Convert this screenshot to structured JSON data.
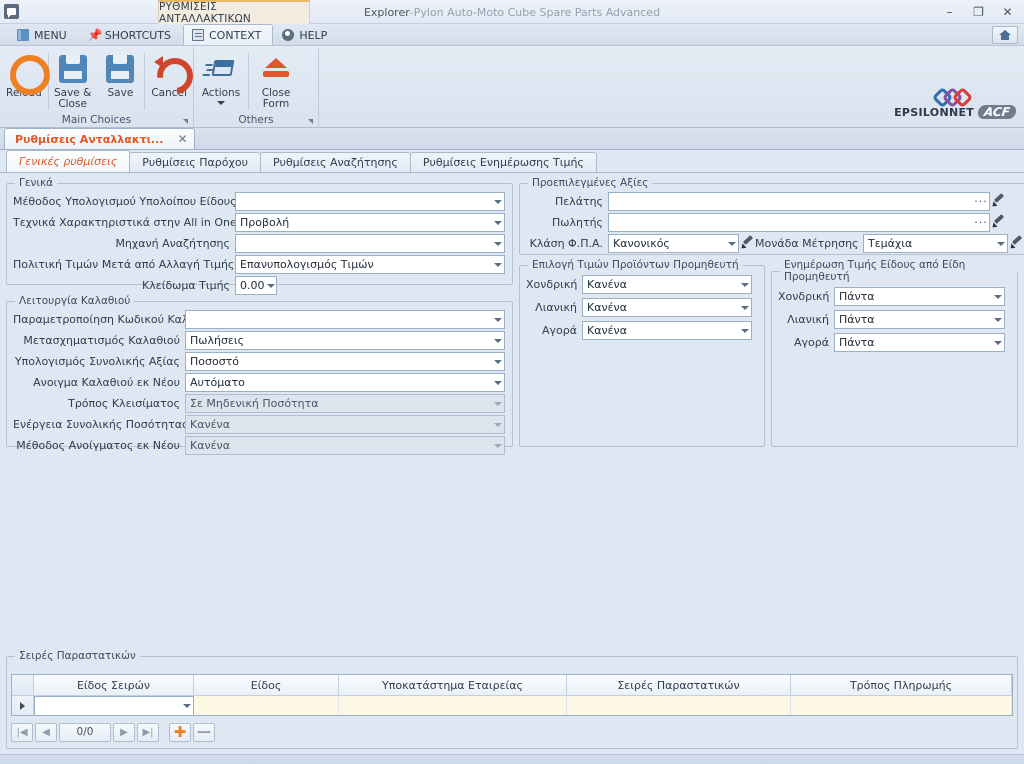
{
  "window": {
    "context_tab": "ΡΥΘΜΙΣΕΙΣ ΑΝΤΑΛΛΑΚΤΙΚΩΝ",
    "title_app": "Explorer",
    "title_sep": " - ",
    "title_doc": "Pylon Auto-Moto Cube Spare Parts Advanced",
    "minimize": "–",
    "restore": "❐",
    "close": "✕"
  },
  "menustrip": {
    "items": [
      {
        "label": "MENU",
        "icon": "menu-icon",
        "active": false
      },
      {
        "label": "SHORTCUTS",
        "icon": "pin-icon",
        "active": false
      },
      {
        "label": "CONTEXT",
        "icon": "context-icon",
        "active": true
      },
      {
        "label": "HELP",
        "icon": "help-icon",
        "active": false
      }
    ],
    "home_icon": "home-icon"
  },
  "ribbon": {
    "groups": [
      {
        "caption": "Main Choices",
        "buttons": [
          {
            "label": "Reload",
            "icon": "reload-icon",
            "dropdown": false
          },
          {
            "label": "Save &\nClose",
            "label_l1": "Save &",
            "label_l2": "Close",
            "icon": "save-icon",
            "dropdown": false
          },
          {
            "label": "Save",
            "icon": "save-icon",
            "dropdown": false
          },
          {
            "label": "Cancel",
            "icon": "cancel-icon",
            "dropdown": false
          }
        ]
      },
      {
        "caption": "Others",
        "buttons": [
          {
            "label": "Actions",
            "icon": "actions-icon",
            "dropdown": true
          },
          {
            "label": "Close\nForm",
            "label_l1": "Close",
            "label_l2": "Form",
            "icon": "close-form-icon",
            "dropdown": false
          }
        ]
      }
    ],
    "logo_text": "EPSILONNET",
    "logo_badge": "ACF"
  },
  "doc_tab": {
    "title": "Ρυθμίσεις Ανταλλακτι...",
    "close": "✕"
  },
  "page_tabs": [
    {
      "label": "Γενικές ρυθμίσεις",
      "active": true
    },
    {
      "label": "Ρυθμίσεις Παρόχου",
      "active": false
    },
    {
      "label": "Ρυθμίσεις Αναζήτησης",
      "active": false
    },
    {
      "label": "Ρυθμίσεις Ενημέρωσης Τιμής",
      "active": false
    }
  ],
  "general_group": {
    "caption": "Γενικά",
    "fields": [
      {
        "label": "Μέθοδος Υπολογισμού Υπολοίπου Είδους",
        "value": "",
        "type": "combo",
        "disabled": false
      },
      {
        "label": "Τεχνικά Χαρακτηριστικά στην All in One",
        "value": "Προβολή",
        "type": "combo",
        "disabled": false
      },
      {
        "label": "Μηχανή Αναζήτησης",
        "value": "",
        "type": "combo",
        "disabled": false
      },
      {
        "label": "Πολιτική Τιμών Μετά από Αλλαγή Τιμής Αγοράς",
        "value": "Επανυπολογισμός Τιμών",
        "type": "combo",
        "disabled": false
      },
      {
        "label": "Κλείδωμα Τιμής",
        "value": "0.00",
        "type": "spin",
        "disabled": false
      }
    ]
  },
  "cart_group": {
    "caption": "Λειτουργία Καλαθιού",
    "fields": [
      {
        "label": "Παραμετροποίηση Κωδικού Καλαθιού",
        "value": "",
        "type": "combo",
        "disabled": false
      },
      {
        "label": "Μετασχηματισμός Καλαθιού",
        "value": "Πωλήσεις",
        "type": "combo",
        "disabled": false
      },
      {
        "label": "Υπολογισμός Συνολικής Αξίας",
        "value": "Ποσοστό",
        "type": "combo",
        "disabled": false
      },
      {
        "label": "Ανοιγμα Καλαθιού εκ Νέου",
        "value": "Αυτόματο",
        "type": "combo",
        "disabled": false
      },
      {
        "label": "Τρόπος Κλεισίματος",
        "value": "Σε Μηδενική Ποσότητα",
        "type": "combo",
        "disabled": true
      },
      {
        "label": "Ενέργεια Συνολικής Ποσότητας",
        "value": "Κανένα",
        "type": "combo",
        "disabled": true
      },
      {
        "label": "Μέθοδος Ανοίγματος εκ Νέου",
        "value": "Κανένα",
        "type": "combo",
        "disabled": true
      }
    ]
  },
  "defaults_group": {
    "caption": "Προεπιλεγμένες Αξίες",
    "fields": [
      {
        "label": "Πελάτης",
        "value": "",
        "type": "lookup"
      },
      {
        "label": "Πωλητής",
        "value": "",
        "type": "lookup"
      },
      {
        "label": "Κλάση Φ.Π.Α.",
        "value": "Κανονικός",
        "type": "combo-edit"
      },
      {
        "label": "Μονάδα Μέτρησης",
        "value": "Τεμάχια",
        "type": "combo-edit"
      }
    ]
  },
  "supplier_prices_group": {
    "caption": "Επιλογή Τιμών Προϊόντων Προμηθευτή",
    "fields": [
      {
        "label": "Χονδρική",
        "value": "Κανένα"
      },
      {
        "label": "Λιανική",
        "value": "Κανένα"
      },
      {
        "label": "Αγορά",
        "value": "Κανένα"
      }
    ]
  },
  "price_update_group": {
    "caption": "Ενημέρωση Τιμής Είδους από Είδη Προμηθευτή",
    "fields": [
      {
        "label": "Χονδρική",
        "value": "Πάντα"
      },
      {
        "label": "Λιανική",
        "value": "Πάντα"
      },
      {
        "label": "Αγορά",
        "value": "Πάντα"
      }
    ]
  },
  "series_grid": {
    "caption": "Σειρές Παραστατικών",
    "columns": [
      "Είδος Σειρών",
      "Είδος",
      "Υποκατάστημα Εταιρείας",
      "Σειρές Παραστατικών",
      "Τρόπος Πληρωμής"
    ],
    "rows": [
      {
        "cells": [
          "",
          "",
          "",
          "",
          ""
        ]
      }
    ],
    "nav": {
      "first": "|◀",
      "prev": "◀",
      "position": "0/0",
      "next": "▶",
      "last": "▶|",
      "add": "✚",
      "remove": "—"
    }
  },
  "colors": {
    "accent_orange": "#e05a24",
    "ribbon_blue": "#5086b8",
    "window_bg": "#dfe7f2",
    "grid_row_yellow": "#fdf8e3"
  }
}
